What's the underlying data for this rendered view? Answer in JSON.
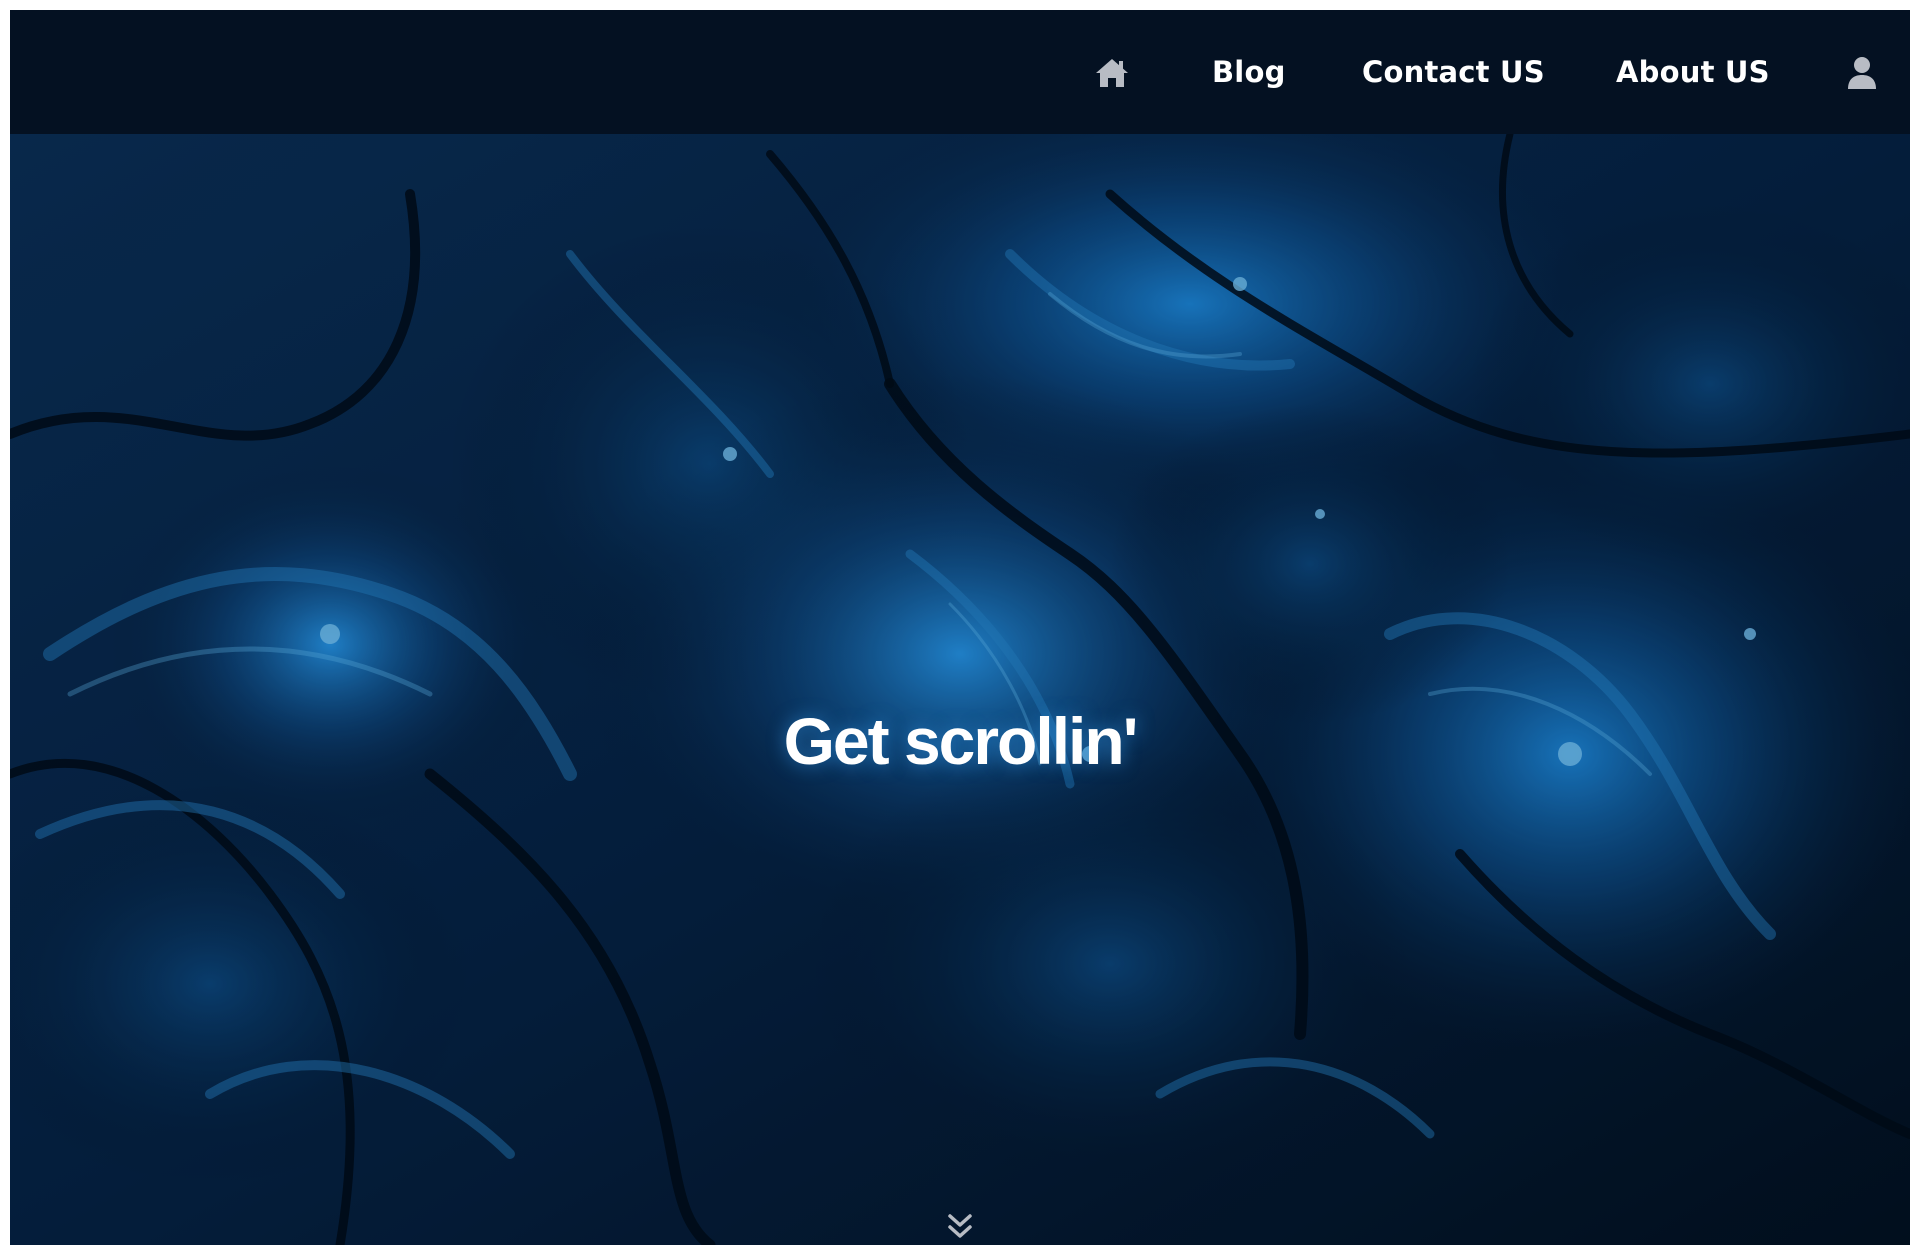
{
  "nav": {
    "home_icon": "home-icon",
    "items": [
      {
        "label": "Blog"
      },
      {
        "label": "Contact US"
      },
      {
        "label": "About US"
      }
    ],
    "user_icon": "user-icon"
  },
  "hero": {
    "title": "Get scrollin'",
    "scroll_icon": "double-chevron-down-icon"
  },
  "colors": {
    "navbar_bg": "#041122",
    "hero_base": "#03142a",
    "nav_text": "#ffffff",
    "icon_gray": "#b8bcc4"
  }
}
